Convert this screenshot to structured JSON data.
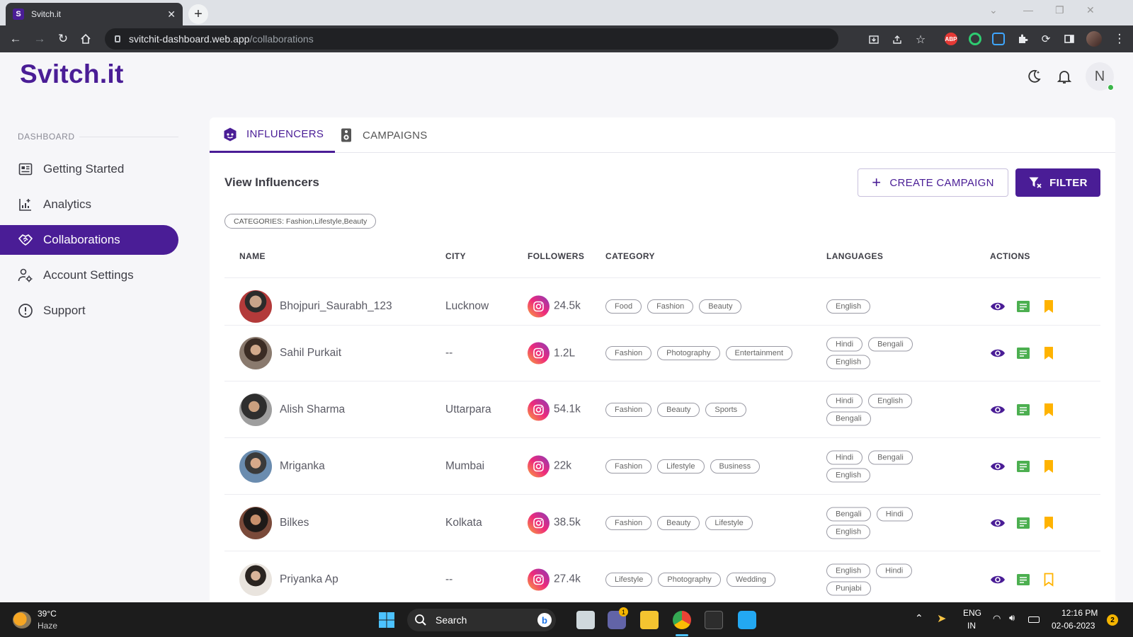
{
  "browser": {
    "tab_title": "Svitch.it",
    "favicon": "S",
    "url_host": "svitchit-dashboard.web.app",
    "url_path": "/collaborations",
    "extensions": {
      "abp": "ABP"
    }
  },
  "header": {
    "logo": "Svitch.it",
    "avatar_initial": "N"
  },
  "sidebar": {
    "section": "DASHBOARD",
    "items": [
      {
        "label": "Getting Started",
        "icon": "newspaper-icon"
      },
      {
        "label": "Analytics",
        "icon": "analytics-icon"
      },
      {
        "label": "Collaborations",
        "icon": "handshake-icon",
        "active": true
      },
      {
        "label": "Account Settings",
        "icon": "user-settings-icon"
      },
      {
        "label": "Support",
        "icon": "info-circle-icon"
      }
    ]
  },
  "main": {
    "tabs": [
      {
        "label": "INFLUENCERS",
        "active": true
      },
      {
        "label": "CAMPAIGNS"
      }
    ],
    "title": "View Influencers",
    "create_label": "CREATE CAMPAIGN",
    "filter_label": "FILTER",
    "filter_chip": "CATEGORIES: Fashion,Lifestyle,Beauty",
    "columns": [
      "NAME",
      "CITY",
      "FOLLOWERS",
      "CATEGORY",
      "LANGUAGES",
      "ACTIONS"
    ],
    "rows": [
      {
        "name": "Bhojpuri_Saurabh_123",
        "city": "Lucknow",
        "followers": "24.5k",
        "categories": [
          "Food",
          "Fashion",
          "Beauty"
        ],
        "languages": [
          "English"
        ],
        "bookmarked": true
      },
      {
        "name": "Sahil Purkait",
        "city": "--",
        "followers": "1.2L",
        "categories": [
          "Fashion",
          "Photography",
          "Entertainment"
        ],
        "languages": [
          "Hindi",
          "Bengali",
          "English"
        ],
        "bookmarked": true
      },
      {
        "name": "Alish Sharma",
        "city": "Uttarpara",
        "followers": "54.1k",
        "categories": [
          "Fashion",
          "Beauty",
          "Sports"
        ],
        "languages": [
          "Hindi",
          "English",
          "Bengali"
        ],
        "bookmarked": true
      },
      {
        "name": "Mriganka",
        "city": "Mumbai",
        "followers": "22k",
        "categories": [
          "Fashion",
          "Lifestyle",
          "Business"
        ],
        "languages": [
          "Hindi",
          "Bengali",
          "English"
        ],
        "bookmarked": true
      },
      {
        "name": "Bilkes",
        "city": "Kolkata",
        "followers": "38.5k",
        "categories": [
          "Fashion",
          "Beauty",
          "Lifestyle"
        ],
        "languages": [
          "Bengali",
          "Hindi",
          "English"
        ],
        "bookmarked": true
      },
      {
        "name": "Priyanka Ap",
        "city": "--",
        "followers": "27.4k",
        "categories": [
          "Lifestyle",
          "Photography",
          "Wedding"
        ],
        "languages": [
          "English",
          "Hindi",
          "Punjabi"
        ],
        "bookmarked": false
      }
    ]
  },
  "taskbar": {
    "weather_temp": "39°C",
    "weather_desc": "Haze",
    "search_label": "Search",
    "teams_badge": "1",
    "lang_top": "ENG",
    "lang_bottom": "IN",
    "time": "12:16 PM",
    "date": "02-06-2023",
    "notification_count": "2"
  },
  "colors": {
    "brand": "#4a1d96",
    "action_green": "#4caf50",
    "bookmark_amber": "#ffb300"
  }
}
